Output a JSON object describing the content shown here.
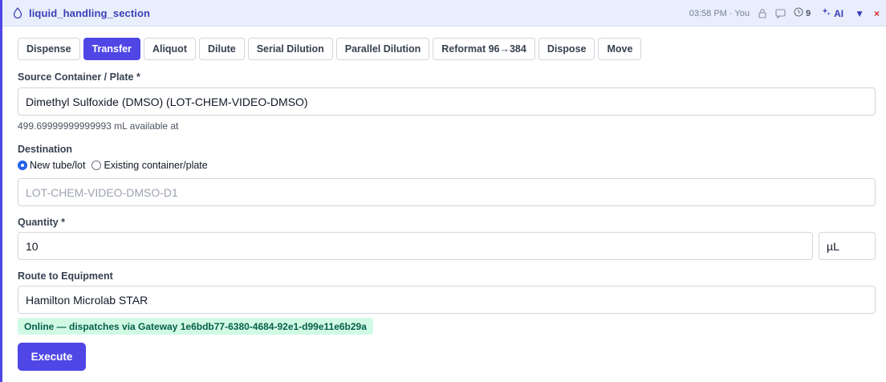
{
  "header": {
    "title": "liquid_handling_section",
    "meta": "03:58 PM · You",
    "history_count": "9",
    "ai_label": "AI",
    "collapse_glyph": "▼",
    "close_glyph": "×",
    "icons": [
      "drop-icon",
      "lock-icon",
      "comment-icon",
      "history-icon",
      "sparkle-icon"
    ],
    "accent_color": "#4f46e5"
  },
  "tabs": [
    {
      "label": "Dispense",
      "active": false
    },
    {
      "label": "Transfer",
      "active": true
    },
    {
      "label": "Aliquot",
      "active": false
    },
    {
      "label": "Dilute",
      "active": false
    },
    {
      "label": "Serial Dilution",
      "active": false
    },
    {
      "label": "Parallel Dilution",
      "active": false
    },
    {
      "label": "Reformat 96→384",
      "active": false
    },
    {
      "label": "Dispose",
      "active": false
    },
    {
      "label": "Move",
      "active": false
    }
  ],
  "source": {
    "label": "Source Container / Plate *",
    "value": "Dimethyl Sulfoxide (DMSO) (LOT-CHEM-VIDEO-DMSO)",
    "availability": "499.69999999999993 mL available at"
  },
  "destination": {
    "label": "Destination",
    "options": [
      {
        "label": "New tube/lot",
        "checked": true
      },
      {
        "label": "Existing container/plate",
        "checked": false
      }
    ],
    "placeholder": "LOT-CHEM-VIDEO-DMSO-D1"
  },
  "quantity": {
    "label": "Quantity *",
    "value": "10",
    "unit": "µL"
  },
  "route": {
    "label": "Route to Equipment",
    "value": "Hamilton Microlab STAR",
    "status": "Online — dispatches via Gateway 1e6bdb77-6380-4684-92e1-d99e11e6b29a",
    "status_color": "#065f46"
  },
  "actions": {
    "execute_label": "Execute"
  }
}
